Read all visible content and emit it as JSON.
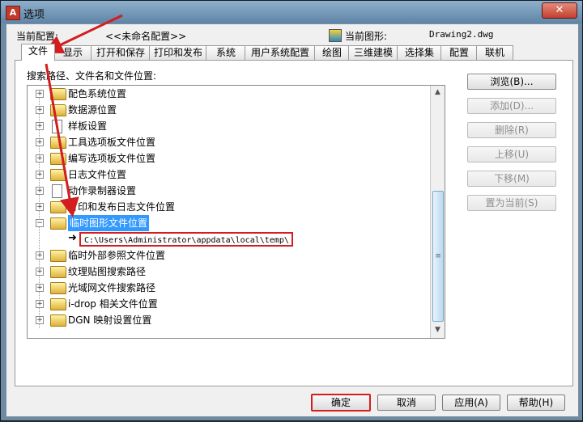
{
  "window": {
    "title": "选项",
    "close_glyph": "✕",
    "app_icon_glyph": "A"
  },
  "profile": {
    "current_profile_label": "当前配置:",
    "current_profile_value": "<<未命名配置>>",
    "current_drawing_label": "当前图形:",
    "current_drawing_value": "Drawing2.dwg"
  },
  "tabs": [
    "文件",
    "显示",
    "打开和保存",
    "打印和发布",
    "系统",
    "用户系统配置",
    "绘图",
    "三维建模",
    "选择集",
    "配置",
    "联机"
  ],
  "active_tab": "文件",
  "panel_label": "搜索路径、文件名和文件位置:",
  "tree": {
    "items": [
      {
        "label": "配色系统位置",
        "icon": "folder-icon"
      },
      {
        "label": "数据源位置",
        "icon": "folder-icon"
      },
      {
        "label": "样板设置",
        "icon": "document-icon"
      },
      {
        "label": "工具选项板文件位置",
        "icon": "folder-icon"
      },
      {
        "label": "编写选项板文件位置",
        "icon": "folder-icon"
      },
      {
        "label": "日志文件位置",
        "icon": "folder-icon"
      },
      {
        "label": "动作录制器设置",
        "icon": "document-icon"
      },
      {
        "label": "打印和发布日志文件位置",
        "icon": "folder-icon"
      },
      {
        "label": "临时图形文件位置",
        "icon": "folder-icon",
        "expanded": true,
        "selected": true
      },
      {
        "label": "临时外部参照文件位置",
        "icon": "folder-icon"
      },
      {
        "label": "纹理贴图搜索路径",
        "icon": "folder-icon"
      },
      {
        "label": "光域网文件搜索路径",
        "icon": "folder-icon"
      },
      {
        "label": "i-drop 相关文件位置",
        "icon": "folder-icon"
      },
      {
        "label": "DGN 映射设置位置",
        "icon": "folder-icon"
      }
    ],
    "expanded_child_value": "C:\\Users\\Administrator\\appdata\\local\\temp\\"
  },
  "side_buttons": [
    {
      "label": "浏览(B)...",
      "enabled": true
    },
    {
      "label": "添加(D)...",
      "enabled": false
    },
    {
      "label": "删除(R)",
      "enabled": false
    },
    {
      "label": "上移(U)",
      "enabled": false
    },
    {
      "label": "下移(M)",
      "enabled": false
    },
    {
      "label": "置为当前(S)",
      "enabled": false
    }
  ],
  "bottom_buttons": [
    {
      "label": "确定",
      "key": "ok"
    },
    {
      "label": "取消",
      "key": "cancel"
    },
    {
      "label": "应用(A)",
      "key": "apply"
    },
    {
      "label": "帮助(H)",
      "key": "help"
    }
  ],
  "colors": {
    "annotation_red": "#d21e1e",
    "selection_blue": "#3399ff"
  }
}
